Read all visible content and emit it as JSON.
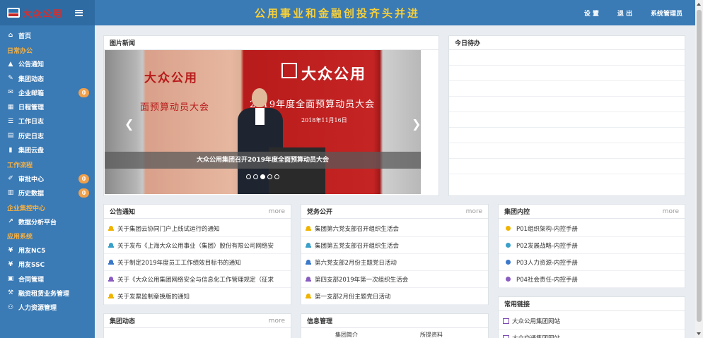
{
  "sidebar": {
    "logo_text": "大众公用",
    "items": [
      {
        "type": "item",
        "icon": "home-icon",
        "label": "首页"
      },
      {
        "type": "section",
        "label": "日常办公"
      },
      {
        "type": "item",
        "icon": "warning-icon",
        "label": "公告通知"
      },
      {
        "type": "item",
        "icon": "pencil-icon",
        "label": "集团动态"
      },
      {
        "type": "item",
        "icon": "envelope-icon",
        "label": "企业邮箱",
        "badge": "0"
      },
      {
        "type": "item",
        "icon": "calendar-icon",
        "label": "日程管理"
      },
      {
        "type": "item",
        "icon": "list-icon",
        "label": "工作日志"
      },
      {
        "type": "item",
        "icon": "book-icon",
        "label": "历史日志"
      },
      {
        "type": "item",
        "icon": "file-icon",
        "label": "集团云盘"
      },
      {
        "type": "section",
        "label": "工作流程"
      },
      {
        "type": "item",
        "icon": "edit-icon",
        "label": "审批中心",
        "badge": "0"
      },
      {
        "type": "item",
        "icon": "chart-bar-icon",
        "label": "历史数据",
        "badge": "0"
      },
      {
        "type": "section",
        "label": "企业集控中心"
      },
      {
        "type": "item",
        "icon": "line-chart-icon",
        "label": "数据分析平台"
      },
      {
        "type": "section",
        "label": "应用系统"
      },
      {
        "type": "item",
        "icon": "yen-icon",
        "label": "用友NC5"
      },
      {
        "type": "item",
        "icon": "yen-icon",
        "label": "用友SSC"
      },
      {
        "type": "item",
        "icon": "contract-icon",
        "label": "合同管理"
      },
      {
        "type": "item",
        "icon": "gavel-icon",
        "label": "融资租赁业务管理"
      },
      {
        "type": "item",
        "icon": "users-icon",
        "label": "人力资源管理"
      }
    ]
  },
  "header": {
    "banner": "公用事业和金融创投齐头并进",
    "links": [
      "设 置",
      "退 出",
      "系统管理员"
    ]
  },
  "photo_news": {
    "title": "图片新闻",
    "slide": {
      "left_title": "大众公用",
      "left_sub": "面预算动员大会",
      "right_title": "大众公用",
      "right_sub": "2019年度全面预算动员大会",
      "date": "2018年11月16日"
    },
    "caption": "大众公用集团召开2019年度全面预算动员大会",
    "dots": 5,
    "active_dot": 3
  },
  "todo": {
    "title": "今日待办"
  },
  "notices": {
    "title": "公告通知",
    "more": "more",
    "items": [
      {
        "text": "关于集团云协同门户上线试运行的通知",
        "color": "#f0b400"
      },
      {
        "text": "关于发布《上海大众公用事业（集团）股份有限公司网络安",
        "color": "#3aa0c9"
      },
      {
        "text": "关于制定2019年度员工工作绩效目标书的通知",
        "color": "#3b78c9"
      },
      {
        "text": "关于《大众公用集团网络安全与信息化工作管理规定（征求",
        "color": "#8a5cc2"
      },
      {
        "text": "关于发票监制章换版的通知",
        "color": "#f0b400"
      }
    ]
  },
  "party": {
    "title": "党务公开",
    "more": "more",
    "items": [
      {
        "text": "集团第六党支部召开组织生活会",
        "color": "#f0b400"
      },
      {
        "text": "集团第五党支部召开组织生活会",
        "color": "#3aa0c9"
      },
      {
        "text": "第六党支部2月份主题党日活动",
        "color": "#3b78c9"
      },
      {
        "text": "第四支部2019年第一次组织生活会",
        "color": "#8a5cc2"
      },
      {
        "text": "第一支部2月份主题党日活动",
        "color": "#f0b400"
      }
    ]
  },
  "control": {
    "title": "集团内控",
    "more": "more",
    "items": [
      {
        "text": "P01组织架构-内控手册",
        "color": "#f0b400"
      },
      {
        "text": "P02发展战略-内控手册",
        "color": "#3aa0c9"
      },
      {
        "text": "P03人力资源-内控手册",
        "color": "#3b78c9"
      },
      {
        "text": "P04社会责任-内控手册",
        "color": "#8a5cc2"
      }
    ]
  },
  "dynamics": {
    "title": "集团动态",
    "more": "more"
  },
  "info": {
    "title": "信息管理",
    "col1": "集团简介",
    "col2": "所提资料"
  },
  "links": {
    "title": "常用链接",
    "items": [
      "大众公用集团网站",
      "大众交通集团网站"
    ]
  }
}
